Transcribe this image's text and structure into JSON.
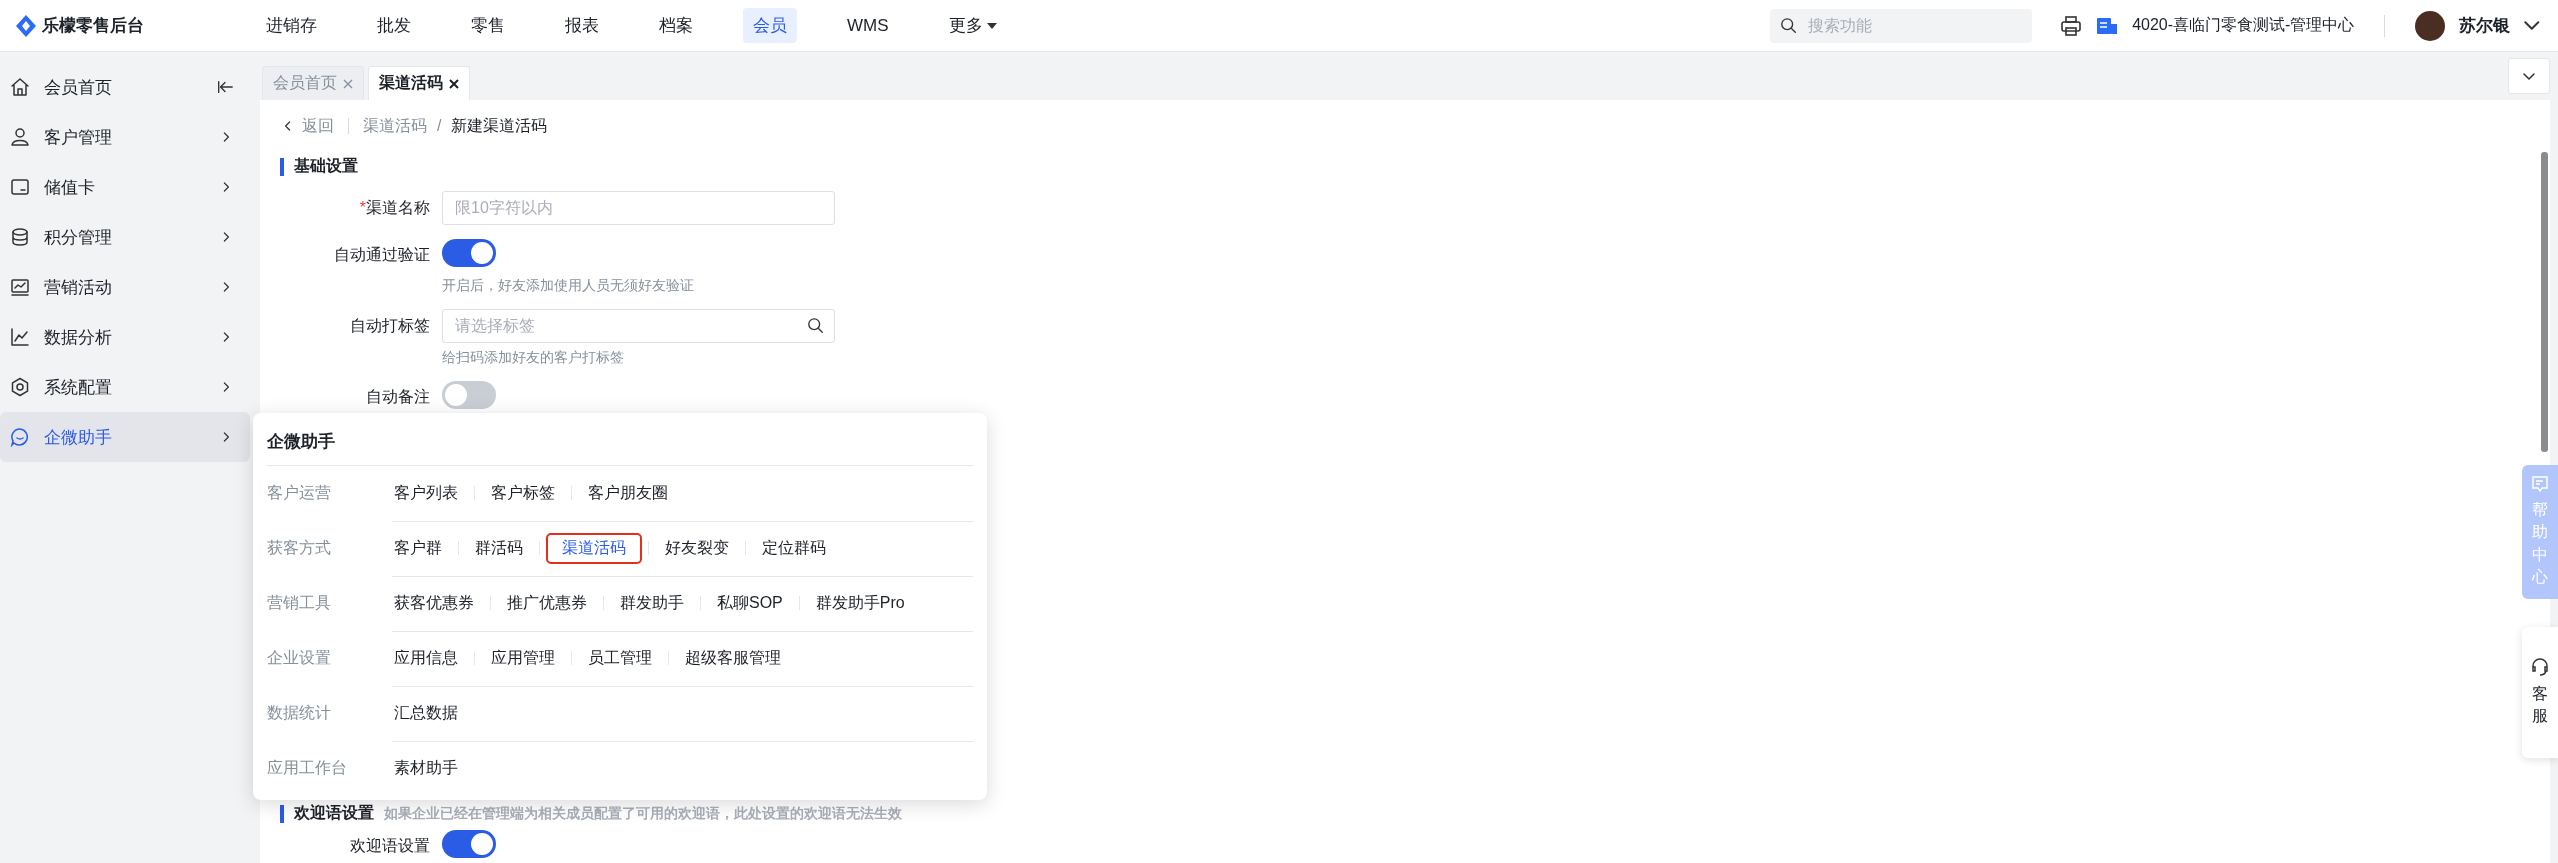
{
  "brand": {
    "name": "乐檬零售后台"
  },
  "top_nav": [
    {
      "label": "进销存",
      "selected": false,
      "kind": "link"
    },
    {
      "label": "批发",
      "selected": false,
      "kind": "link"
    },
    {
      "label": "零售",
      "selected": false,
      "kind": "link"
    },
    {
      "label": "报表",
      "selected": false,
      "kind": "link"
    },
    {
      "label": "档案",
      "selected": false,
      "kind": "link"
    },
    {
      "label": "会员",
      "selected": true,
      "kind": "link"
    },
    {
      "label": "WMS",
      "selected": false,
      "kind": "link"
    },
    {
      "label": "更多",
      "selected": false,
      "kind": "dropdown"
    }
  ],
  "search": {
    "placeholder": "搜索功能"
  },
  "store": {
    "name": "4020-喜临门零食测试-管理中心"
  },
  "user": {
    "name": "苏尔银"
  },
  "sidebar": {
    "items": [
      {
        "label": "会员首页",
        "selected": false,
        "kind": "collapse"
      },
      {
        "label": "客户管理",
        "selected": false,
        "kind": "menu"
      },
      {
        "label": "储值卡",
        "selected": false,
        "kind": "menu"
      },
      {
        "label": "积分管理",
        "selected": false,
        "kind": "menu"
      },
      {
        "label": "营销活动",
        "selected": false,
        "kind": "menu"
      },
      {
        "label": "数据分析",
        "selected": false,
        "kind": "menu"
      },
      {
        "label": "系统配置",
        "selected": false,
        "kind": "menu"
      },
      {
        "label": "企微助手",
        "selected": true,
        "kind": "menu"
      }
    ]
  },
  "tabs": [
    {
      "label": "会员首页",
      "selected": false
    },
    {
      "label": "渠道活码",
      "selected": true
    }
  ],
  "breadcrumb": {
    "back": "返回",
    "separator": "/",
    "items": [
      "渠道活码",
      "新建渠道活码"
    ]
  },
  "required_mark": "*",
  "sections": [
    {
      "title": "基础设置",
      "fields": [
        {
          "label": "渠道名称",
          "required": true,
          "kind": "input",
          "placeholder": "限10字符以内"
        },
        {
          "label": "自动通过验证",
          "required": false,
          "kind": "switch",
          "on": true,
          "hint": "开启后，好友添加使用人员无须好友验证"
        },
        {
          "label": "自动打标签",
          "required": false,
          "kind": "search",
          "placeholder": "请选择标签",
          "hint": "给扫码添加好友的客户打标签"
        },
        {
          "label": "自动备注",
          "required": false,
          "kind": "switch",
          "on": false
        }
      ]
    },
    {
      "title": "欢迎语设置",
      "note": "如果企业已经在管理端为相关成员配置了可用的欢迎语，此处设置的欢迎语无法生效",
      "fields": [
        {
          "label": "欢迎语设置",
          "required": false,
          "kind": "switch",
          "on": true
        }
      ]
    }
  ],
  "popup": {
    "title": "企微助手",
    "groups": [
      {
        "label": "客户运营",
        "items": [
          {
            "label": "客户列表",
            "selected": false
          },
          {
            "label": "客户标签",
            "selected": false
          },
          {
            "label": "客户朋友圈",
            "selected": false
          }
        ]
      },
      {
        "label": "获客方式",
        "items": [
          {
            "label": "客户群",
            "selected": false
          },
          {
            "label": "群活码",
            "selected": false
          },
          {
            "label": "渠道活码",
            "selected": true
          },
          {
            "label": "好友裂变",
            "selected": false
          },
          {
            "label": "定位群码",
            "selected": false
          }
        ]
      },
      {
        "label": "营销工具",
        "items": [
          {
            "label": "获客优惠券",
            "selected": false
          },
          {
            "label": "推广优惠券",
            "selected": false
          },
          {
            "label": "群发助手",
            "selected": false
          },
          {
            "label": "私聊SOP",
            "selected": false
          },
          {
            "label": "群发助手Pro",
            "selected": false
          }
        ]
      },
      {
        "label": "企业设置",
        "items": [
          {
            "label": "应用信息",
            "selected": false
          },
          {
            "label": "应用管理",
            "selected": false
          },
          {
            "label": "员工管理",
            "selected": false
          },
          {
            "label": "超级客服管理",
            "selected": false
          }
        ]
      },
      {
        "label": "数据统计",
        "items": [
          {
            "label": "汇总数据",
            "selected": false
          }
        ]
      },
      {
        "label": "应用工作台",
        "items": [
          {
            "label": "素材助手",
            "selected": false
          }
        ]
      }
    ]
  },
  "side_float": [
    {
      "label": "帮助中心",
      "kind": "help"
    },
    {
      "label": "客服",
      "kind": "service"
    }
  ]
}
